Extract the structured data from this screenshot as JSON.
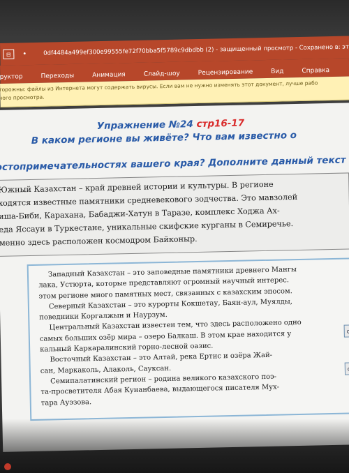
{
  "titlebar": {
    "icon_label": "⊟",
    "dot": "•",
    "title": "0df4484a499ef300e99555fe72f70bba5f5789c9dbdbb (2)  -  защищенный просмотр  -  Сохранено в: эт"
  },
  "ribbon": {
    "tabs": [
      "труктор",
      "Переходы",
      "Анимация",
      "Слайд-шоу",
      "Рецензирование",
      "Вид",
      "Справка"
    ]
  },
  "warning": {
    "line1": "торожны: файлы из Интернета могут содержать вирусы. Если вам не нужно изменять этот документ, лучше рабо",
    "line2": "ного просмотра."
  },
  "slide": {
    "heading1_main": "Упражнение №24 ",
    "heading1_red": "стр16-17",
    "heading2": "В каком регионе вы живёте? Что вам известно о",
    "heading3": "остопримечательностях вашего края? Дополните данный текст",
    "box1_lines": [
      "Южный Казахстан – край древней истории и культуры. В регионе",
      "ходятся известные памятники средневекового зодчества.  Это мавзолей",
      "иша-Биби, Карахана, Бабаджи-Хатун в Таразе, комплекс Ходжа Ах-",
      "еда Яссауи в Туркестане, уникальные  скифские курганы в Семиречье.",
      "менно  здесь расположен космодром Байконыр."
    ],
    "box2_lines": [
      "Западный Казахстан – это заповедные памятники древнего Мангы",
      "лака, Устюрта, которые представляют огромный научный интерес.",
      "этом регионе много  памятных мест,  связанных с казахским эпосом.",
      "Северный Казахстан – это курорты Кокшетау, Баян-аул, Муялды,",
      "поведники Коргалжын и Наурзум.",
      "Центральный Казахстан известен тем, что здесь расположено одно",
      "самых больших озёр мира – озеро Балкаш. В этом крае находится у",
      "кальный Каркаралинский горно-лесной оазис.",
      "Восточный Казахстан – это Алтай, река Ертис и озёра  Жай-",
      "сан, Маркаколь, Алаколь, Сауксан.",
      "Семипалатинский регион – родина великого казахского поэ-",
      "та-просветителя Абая Кунанбаева, выдающегося писателя Мух-",
      "тара  Ауэзова."
    ],
    "side_buttons": [
      "сп",
      "о"
    ]
  }
}
